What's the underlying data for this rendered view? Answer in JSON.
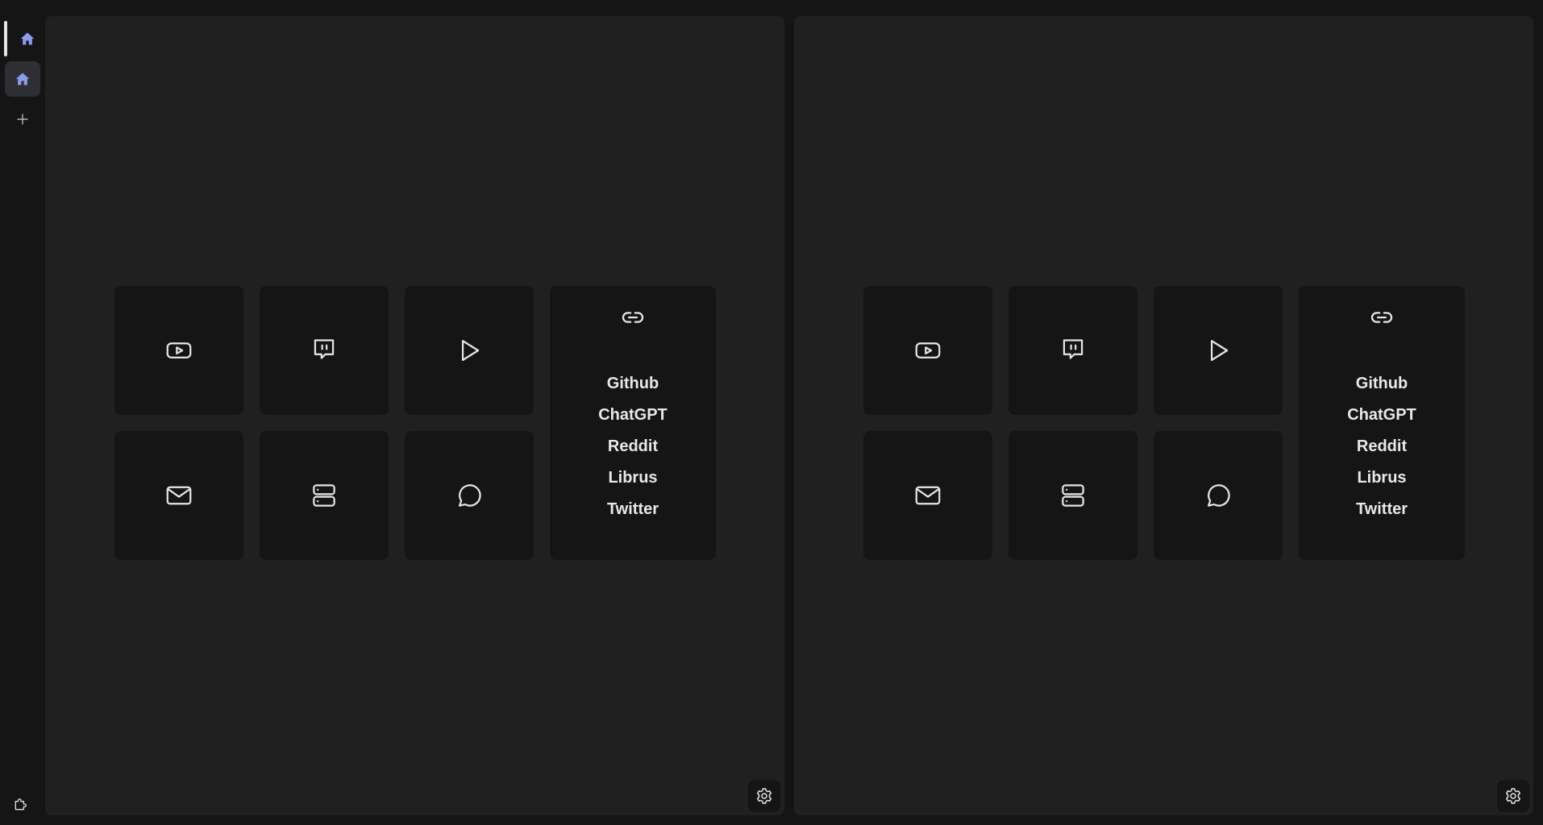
{
  "sidebar": {
    "items": [
      {
        "icon": "home-icon",
        "active": true
      },
      {
        "icon": "home-icon",
        "selected": true
      },
      {
        "icon": "plus-icon"
      }
    ],
    "bottom_icon": "puzzle-icon",
    "accent": "#8b9cf0"
  },
  "panels": [
    {
      "tiles": [
        {
          "icon": "youtube-icon"
        },
        {
          "icon": "twitch-icon"
        },
        {
          "icon": "play-icon"
        },
        {
          "icon": "mail-icon"
        },
        {
          "icon": "server-icon"
        },
        {
          "icon": "chat-bubble-icon"
        }
      ],
      "links": [
        "Github",
        "ChatGPT",
        "Reddit",
        "Librus",
        "Twitter"
      ],
      "settings_icon": "gear-icon"
    },
    {
      "tiles": [
        {
          "icon": "youtube-icon"
        },
        {
          "icon": "twitch-icon"
        },
        {
          "icon": "play-icon"
        },
        {
          "icon": "mail-icon"
        },
        {
          "icon": "server-icon"
        },
        {
          "icon": "chat-bubble-icon"
        }
      ],
      "links": [
        "Github",
        "ChatGPT",
        "Reddit",
        "Librus",
        "Twitter"
      ],
      "settings_icon": "gear-icon"
    }
  ],
  "colors": {
    "background": "#151515",
    "panel": "#202020",
    "tile": "#151515",
    "text": "#e8e8e8"
  }
}
